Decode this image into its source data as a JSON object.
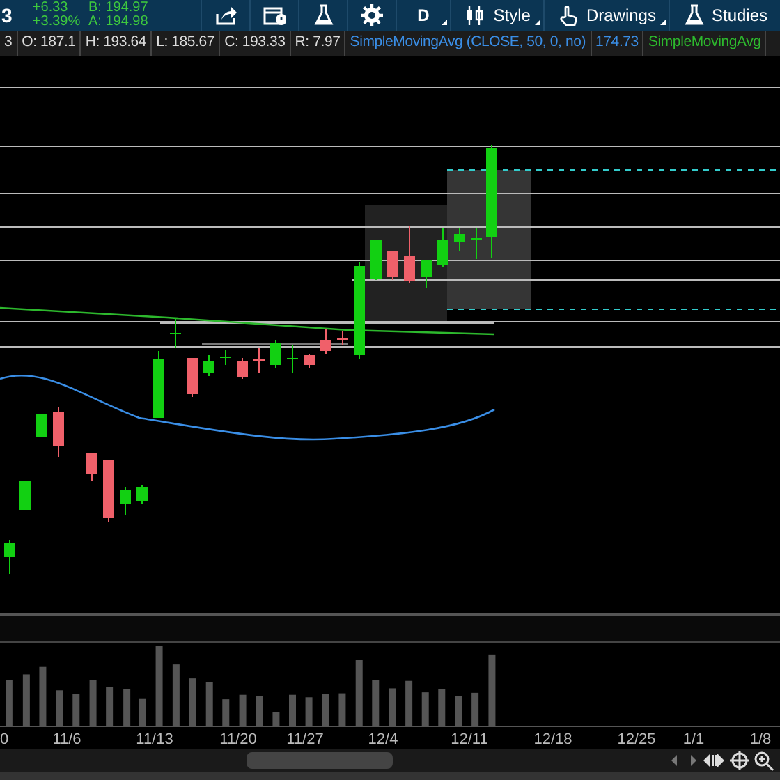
{
  "header": {
    "symbol_fragment": "3",
    "change": "+6.33",
    "change_pct": "+3.39%",
    "bid": "B: 194.97",
    "ask": "A: 194.98",
    "toolbar": [
      {
        "kind": "share"
      },
      {
        "kind": "calendar"
      },
      {
        "kind": "flask"
      },
      {
        "kind": "gear"
      },
      {
        "kind": "menu",
        "label": "D"
      },
      {
        "kind": "candle",
        "label": "Style"
      },
      {
        "kind": "hand",
        "label": "Drawings"
      },
      {
        "kind": "flask",
        "label": "Studies"
      }
    ]
  },
  "info_bar": {
    "cells": [
      "3",
      "O: 187.1",
      "H: 193.64",
      "L: 185.67",
      "C: 193.33",
      "R: 7.97"
    ],
    "studies": [
      {
        "label": "SimpleMovingAvg (CLOSE, 50, 0, no)",
        "value": "174.73",
        "color": "#3a8ee6"
      },
      {
        "label": "SimpleMovingAvg",
        "color": "#2db82d"
      }
    ]
  },
  "x_axis": {
    "labels": [
      "0",
      "11/6",
      "11/13",
      "11/20",
      "11/27",
      "12/4",
      "12/11",
      "12/18",
      "12/25",
      "1/1",
      "1/8"
    ]
  }
}
